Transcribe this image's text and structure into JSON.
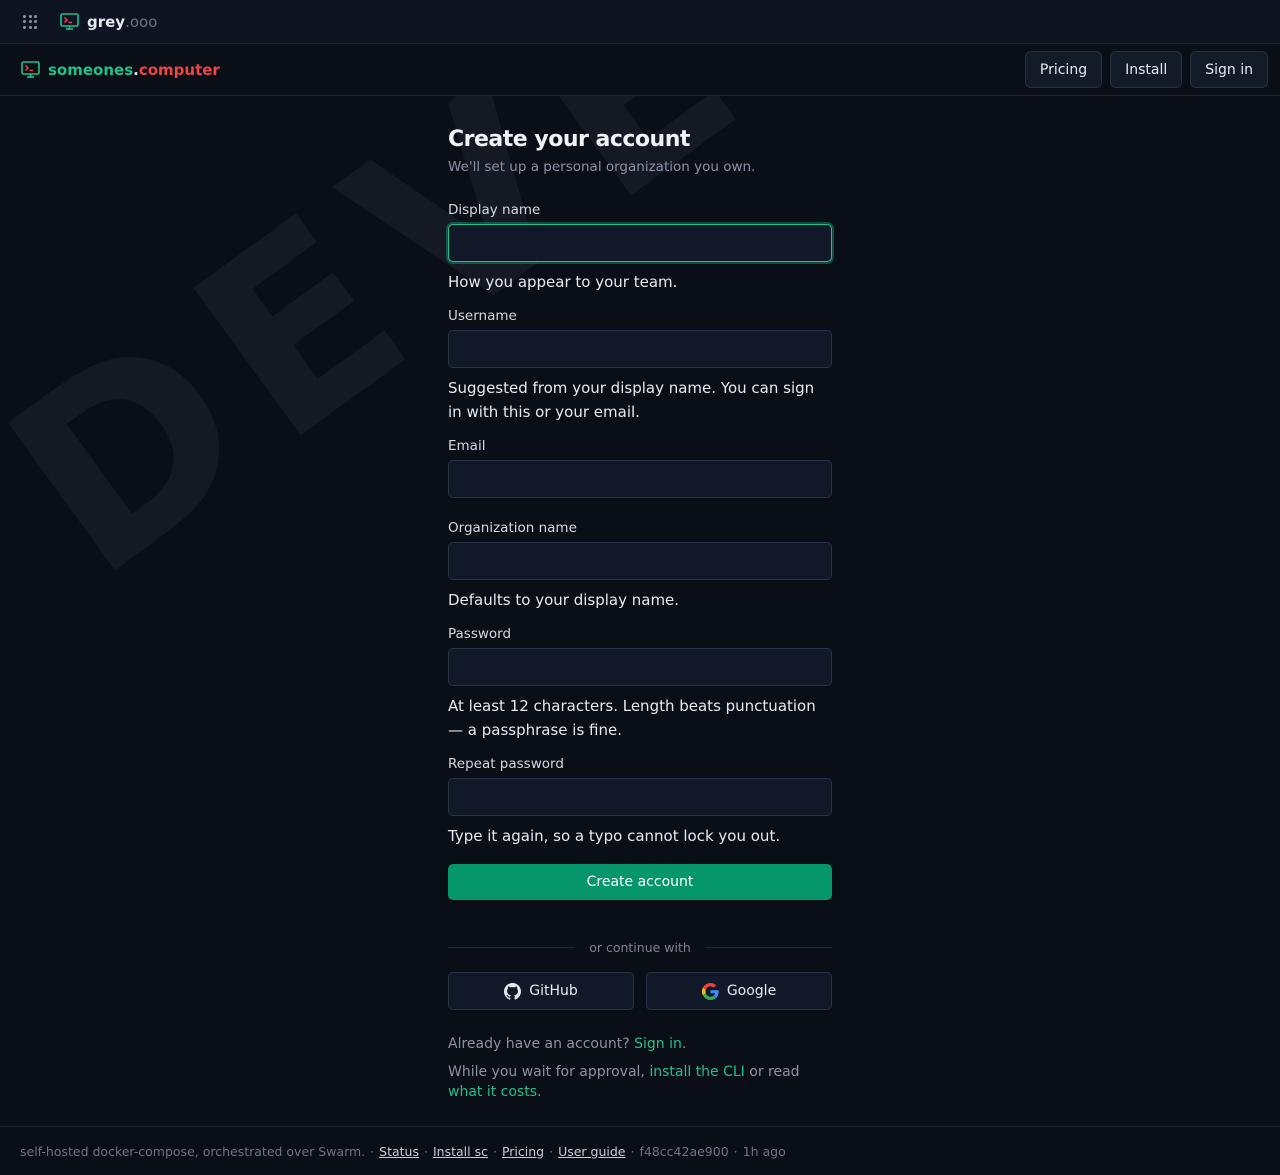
{
  "topbar": {
    "brand_main": "grey",
    "brand_suffix": ".ooo"
  },
  "navbar": {
    "brand_part1": "someones",
    "brand_dot": ".",
    "brand_part2": "computer",
    "pricing": "Pricing",
    "install": "Install",
    "signin": "Sign in"
  },
  "watermark": "DEVELOPMENT",
  "form": {
    "title": "Create your account",
    "subtitle": "We'll set up a personal organization you own.",
    "display_name": {
      "label": "Display name",
      "value": "",
      "hint": "How you appear to your team."
    },
    "username": {
      "label": "Username",
      "value": "",
      "hint": "Suggested from your display name. You can sign in with this or your email."
    },
    "email": {
      "label": "Email",
      "value": ""
    },
    "org_name": {
      "label": "Organization name",
      "value": "",
      "hint": "Defaults to your display name."
    },
    "password": {
      "label": "Password",
      "value": "",
      "hint": "At least 12 characters. Length beats punctuation — a passphrase is fine."
    },
    "repeat_password": {
      "label": "Repeat password",
      "value": "",
      "hint": "Type it again, so a typo cannot lock you out."
    },
    "submit": "Create account",
    "divider": "or continue with",
    "github": "GitHub",
    "google": "Google",
    "already": "Already have an account?",
    "signin_link": "Sign in",
    "period": ".",
    "wait_prefix": "While you wait for approval,",
    "install_cli": "install the CLI",
    "or_read": "or read",
    "what_it_costs": "what it costs",
    "wait_suffix": "."
  },
  "footer": {
    "intro": "self-hosted docker-compose, orchestrated over Swarm.",
    "sep": "·",
    "status": "Status",
    "install_sc": "Install sc",
    "pricing": "Pricing",
    "user_guide": "User guide",
    "commit": "f48cc42ae900",
    "age": "1h ago"
  },
  "colors": {
    "accent": "#22c08a",
    "brand_red": "#ef4444",
    "primary_button": "#059669",
    "background": "#0a0e17"
  },
  "icons": [
    "apps-grid-icon",
    "terminal-monitor-icon",
    "github-icon",
    "google-icon"
  ]
}
